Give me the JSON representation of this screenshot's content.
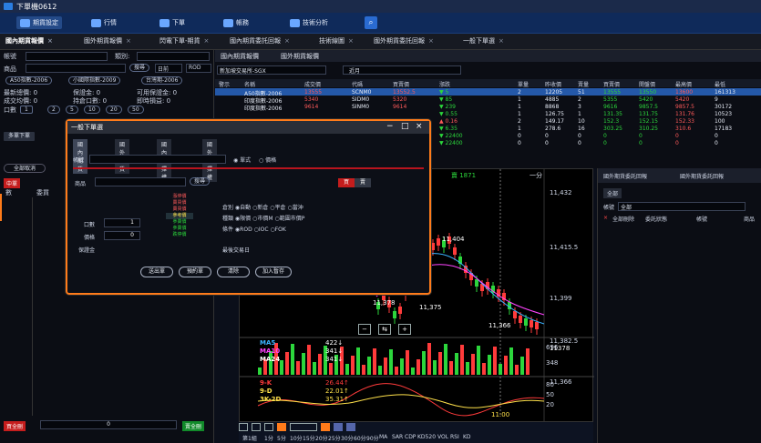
{
  "window": {
    "title": "下單機0612"
  },
  "toolbar": {
    "items": [
      {
        "label": "期貨設定"
      },
      {
        "label": "行情"
      },
      {
        "label": "下單"
      },
      {
        "label": "帳務"
      },
      {
        "label": "技術分析"
      }
    ]
  },
  "tabs": [
    {
      "label": "國內期貨報價"
    },
    {
      "label": "國外期貨報價"
    },
    {
      "label": "閃電下單-期貨"
    },
    {
      "label": "國內期貨委託回報"
    },
    {
      "label": "技術線圖"
    },
    {
      "label": "國外期貨委託回報"
    },
    {
      "label": "一般下單選"
    }
  ],
  "left": {
    "account_label": "帳號",
    "category_label": "類別:",
    "product_label": "商品",
    "search_label": "搜尋",
    "day_label": "日前",
    "rod_label": "ROD",
    "pills": [
      "A50指數-2006",
      "小國際指數-2009",
      "台灣期-2006"
    ],
    "stats": [
      {
        "k": "last_price",
        "label": "最新總價: 0",
        "label2": "保證金: 0",
        "label3": "可用保證金: 0"
      },
      {
        "k": "avg",
        "label": "成交均價: 0",
        "label2": "持倉口數: 0",
        "label3": "即時損益: 0"
      }
    ],
    "qty_label": "口數",
    "qty_values": [
      "1",
      "2",
      "5",
      "10",
      "20",
      "50"
    ],
    "buy_button": "多單下單",
    "cancel_all": "全部取消",
    "red_badge": "中單",
    "col_1": "數",
    "col_2": "委買",
    "bottom_left_badge": "買全刪",
    "bottom_value": "0",
    "bottom_right_badge": "賣全刪"
  },
  "quotes": {
    "tabs": [
      "國內期貨報價",
      "國外期貨報價"
    ],
    "exchange": "新加坡交易所-SGX",
    "month": "近月",
    "headers": [
      "警示",
      "名稱",
      "成交價",
      "代碼",
      "買賣價",
      "漲跌",
      "單量",
      "昨收價",
      "賣量",
      "買賣價",
      "開盤價",
      "最高價",
      "最低"
    ],
    "rows": [
      {
        "name": "A50指數-2006",
        "price": "13555",
        "code": "SCNM0",
        "bid": "13552.5",
        "chg": "▼ 5",
        "vol": "2",
        "last": "12205",
        "qty": "51",
        "ask": "13555",
        "open": "13550",
        "high": "13600",
        "low": "161313",
        "sel": true
      },
      {
        "name": "印度指數-2006",
        "price": "5340",
        "code": "SIDM0",
        "bid": "5320",
        "chg": "▼ 85",
        "vol": "1",
        "last": "4885",
        "qty": "2",
        "ask": "5355",
        "open": "5420",
        "high": "5420",
        "low": "9"
      },
      {
        "name": "印度指數-2006",
        "price": "9614",
        "code": "SINM0",
        "bid": "9614",
        "chg": "▼ 239",
        "vol": "1",
        "last": "8868",
        "qty": "3",
        "ask": "9616",
        "open": "9857.5",
        "high": "9857.5",
        "low": "30172"
      },
      {
        "name": "",
        "price": "",
        "code": "",
        "bid": "",
        "chg": "▼ 0.55",
        "vol": "1",
        "last": "126.75",
        "qty": "1",
        "ask": "131.35",
        "open": "131.75",
        "high": "131.76",
        "low": "10523"
      },
      {
        "name": "",
        "price": "",
        "code": "",
        "bid": "",
        "chg": "▲ 0.16",
        "vol": "2",
        "last": "149.17",
        "qty": "10",
        "ask": "152.3",
        "open": "152.15",
        "high": "152.33",
        "low": "100"
      },
      {
        "name": "",
        "price": "",
        "code": "",
        "bid": "",
        "chg": "▼ 6.35",
        "vol": "1",
        "last": "278.6",
        "qty": "16",
        "ask": "303.25",
        "open": "310.25",
        "high": "310.6",
        "low": "17183"
      },
      {
        "name": "",
        "price": "",
        "code": "",
        "bid": "",
        "chg": "▼ 22400",
        "vol": "0",
        "last": "0",
        "qty": "0",
        "ask": "0",
        "open": "0",
        "high": "0",
        "low": "0"
      },
      {
        "name": "",
        "price": "",
        "code": "",
        "bid": "",
        "chg": "▼ 22400",
        "vol": "0",
        "last": "0",
        "qty": "0",
        "ask": "0",
        "open": "0",
        "high": "0",
        "low": "0"
      }
    ]
  },
  "dialog": {
    "title": "一般下單選",
    "tabs": [
      "國內期貨",
      "國外期貨",
      "國內選擇權",
      "國外選擇權"
    ],
    "account_label": "帳號",
    "radio_single": "單式",
    "radio_combo": "價格",
    "product_label": "商品",
    "search_label": "搜尋",
    "buy": "買",
    "sell": "賣",
    "qty_label": "口數",
    "qty_value": "1",
    "price_label": "價格",
    "price_value": "0",
    "margin_label": "保證金",
    "price_ladder": [
      "漲停價",
      "賣買價",
      "賣買價",
      "參考價",
      "參賣價",
      "參賣價",
      "跌停價"
    ],
    "opt_open_label": "倉別",
    "opt_open_values": [
      "自動",
      "新倉",
      "平倉",
      "當沖"
    ],
    "opt_kind_label": "種類",
    "opt_kind_values": [
      "限價",
      "市價M",
      "範圍市價P"
    ],
    "opt_cond_label": "條件",
    "opt_cond_values": [
      "ROD",
      "IOC",
      "FOK"
    ],
    "last_trade_label": "最後交易日",
    "buttons": [
      "送出單",
      "預約單",
      "清除",
      "加入暫存"
    ]
  },
  "chart": {
    "header_left": "11378",
    "header_right": "賣 1871",
    "minute_label": "一分",
    "y_ticks": [
      "11,432",
      "11,415.5",
      "11,399",
      "11,382.5",
      "11378",
      "11,366"
    ],
    "labels": {
      "hi": "11,404",
      "lo1": "11,378",
      "lo2": "11,375",
      "lo3": "11,366"
    },
    "ma": [
      {
        "name": "MA5",
        "value": "422↓"
      },
      {
        "name": "MA10",
        "value": "341↓"
      },
      {
        "name": "MA24",
        "value": "341↓"
      }
    ],
    "ma_ticks": [
      "696",
      "348"
    ],
    "kd": [
      {
        "name": "9-K",
        "value": "26.44↑"
      },
      {
        "name": "9-D",
        "value": "22.01↑"
      },
      {
        "name": "3K-2D",
        "value": "35.31↑"
      }
    ],
    "kd_ticks": [
      "80",
      "50",
      "20"
    ],
    "time_label": "11:00",
    "bottom_periods": [
      "第1組",
      "1分",
      "5分",
      "10分",
      "15分",
      "20分",
      "25分",
      "30分",
      "60分",
      "90分",
      "MA",
      "SAR",
      "CDP",
      "KD520",
      "VOL",
      "RSI",
      "KD"
    ]
  },
  "right": {
    "tabs": [
      "國外期貨委託回報",
      "國外期貨委託回報"
    ],
    "all_label": "全部",
    "account_label": "帳號",
    "account_value": "全部",
    "headers": [
      "全部刪除",
      "委託狀態",
      "帳號",
      "商品"
    ]
  },
  "colors": {
    "accent": "#ff7b1a",
    "up": "#ff2b2b",
    "down": "#18c418",
    "blue": "#2458a8"
  }
}
